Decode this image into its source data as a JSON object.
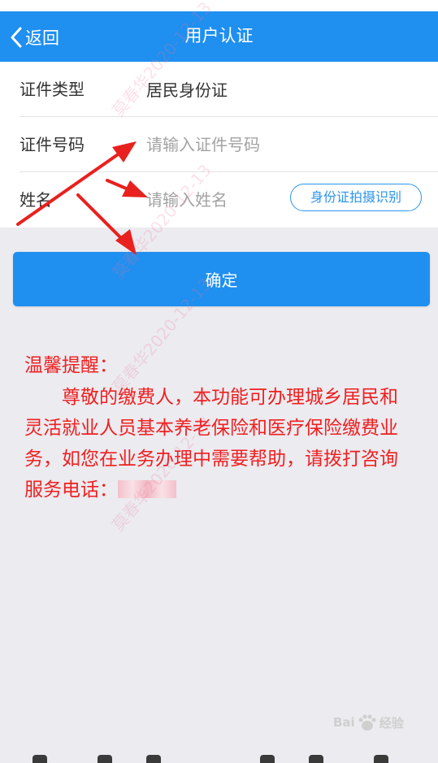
{
  "header": {
    "back_label": "返回",
    "title": "用户认证"
  },
  "form": {
    "id_type": {
      "label": "证件类型",
      "value": "居民身份证"
    },
    "id_number": {
      "label": "证件号码",
      "placeholder": "请输入证件号码"
    },
    "name": {
      "label": "姓名",
      "placeholder": "请输入姓名",
      "scan_label": "身份证拍摄识别"
    }
  },
  "confirm_label": "确定",
  "notice": {
    "title": "温馨提醒：",
    "body": "尊敬的缴费人，本功能可办理城乡居民和灵活就业人员基本养老保险和医疗保险缴费业务，如您在业务办理中需要帮助，请拨打咨询服务电话："
  },
  "watermark": "莫春华2020-12-13",
  "baidu_logo": {
    "left": "Bai",
    "right": "经验"
  },
  "colors": {
    "primary": "#1f8ff0",
    "notice": "#f01f1f",
    "background": "#ebebf0",
    "annotation_arrow": "#e8211e"
  }
}
